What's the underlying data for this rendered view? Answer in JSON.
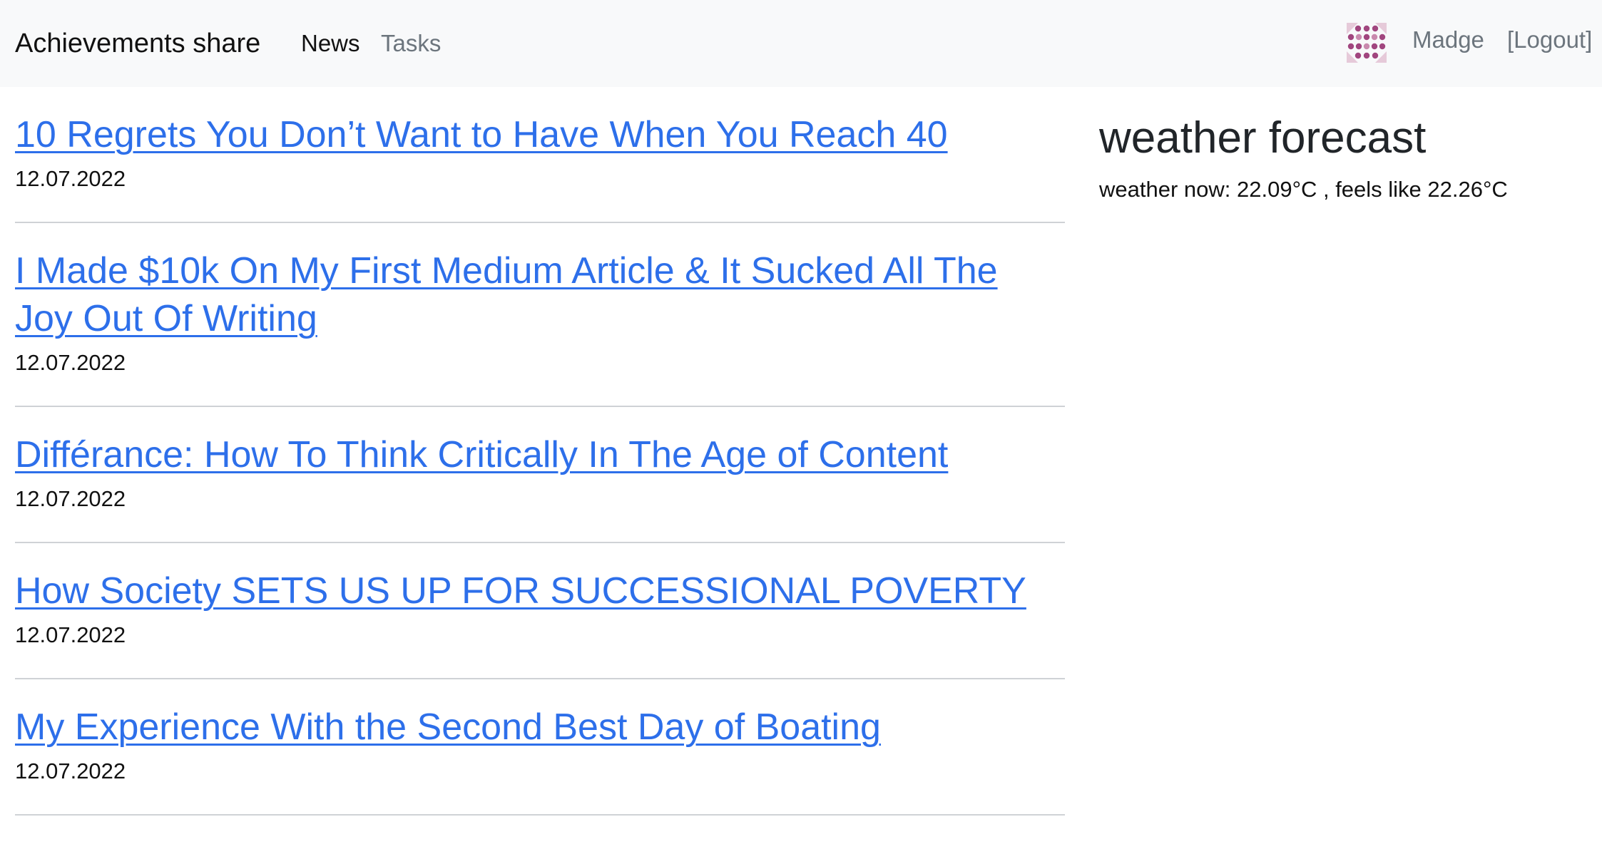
{
  "navbar": {
    "brand": "Achievements share",
    "links": [
      {
        "label": "News",
        "active": true
      },
      {
        "label": "Tasks",
        "active": false
      }
    ],
    "user": {
      "avatar_icon": "identicon-avatar",
      "name": "Madge",
      "logout_label": "[Logout]"
    }
  },
  "articles": [
    {
      "title": "10 Regrets You Don’t Want to Have When You Reach 40",
      "date": "12.07.2022"
    },
    {
      "title": "I Made $10k On My First Medium Article & It Sucked All The Joy Out Of Writing",
      "date": "12.07.2022"
    },
    {
      "title": "Différance: How To Think Critically In The Age of Content",
      "date": "12.07.2022"
    },
    {
      "title": "How Society SETS US UP FOR SUCCESSIONAL POVERTY",
      "date": "12.07.2022"
    },
    {
      "title": "My Experience With the Second Best Day of Boating",
      "date": "12.07.2022"
    }
  ],
  "weather": {
    "title": "weather forecast",
    "now": "weather now: 22.09°C , feels like 22.26°C"
  },
  "colors": {
    "navbar_bg": "#f8f9fa",
    "link": "#2d6fea",
    "muted": "#6c757d",
    "avatar_main": "#a1467f",
    "avatar_light": "#e6cad9"
  }
}
